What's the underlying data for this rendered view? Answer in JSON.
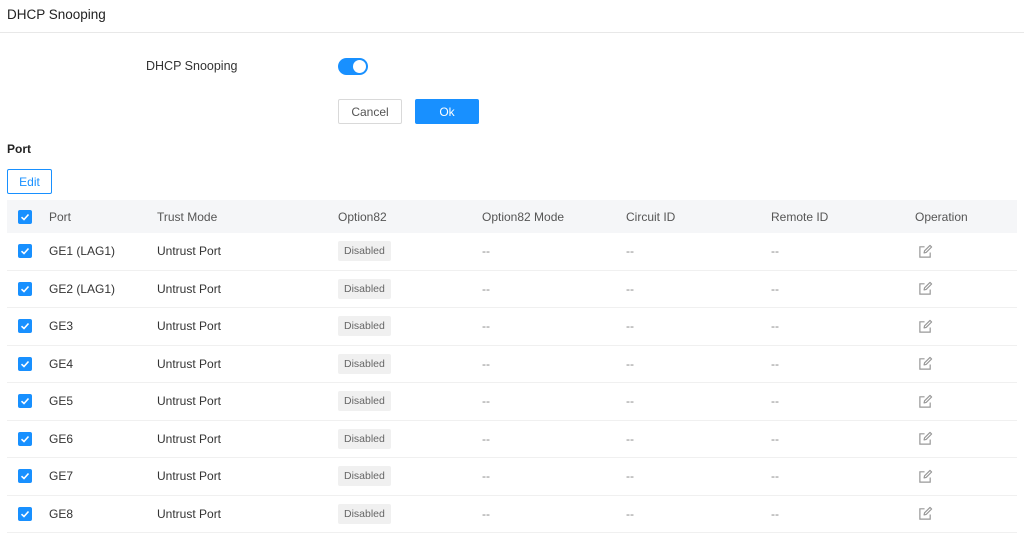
{
  "page": {
    "title": "DHCP Snooping"
  },
  "settings": {
    "dhcp_snooping_label": "DHCP Snooping",
    "dhcp_snooping_enabled": true,
    "cancel_label": "Cancel",
    "ok_label": "Ok"
  },
  "port_section": {
    "title": "Port",
    "edit_label": "Edit",
    "columns": {
      "port": "Port",
      "trust_mode": "Trust Mode",
      "option82": "Option82",
      "option82_mode": "Option82 Mode",
      "circuit_id": "Circuit ID",
      "remote_id": "Remote ID",
      "operation": "Operation"
    },
    "rows": [
      {
        "port": "GE1 (LAG1)",
        "trust_mode": "Untrust Port",
        "option82": "Disabled",
        "option82_mode": "--",
        "circuit_id": "--",
        "remote_id": "--",
        "checked": true
      },
      {
        "port": "GE2 (LAG1)",
        "trust_mode": "Untrust Port",
        "option82": "Disabled",
        "option82_mode": "--",
        "circuit_id": "--",
        "remote_id": "--",
        "checked": true
      },
      {
        "port": "GE3",
        "trust_mode": "Untrust Port",
        "option82": "Disabled",
        "option82_mode": "--",
        "circuit_id": "--",
        "remote_id": "--",
        "checked": true
      },
      {
        "port": "GE4",
        "trust_mode": "Untrust Port",
        "option82": "Disabled",
        "option82_mode": "--",
        "circuit_id": "--",
        "remote_id": "--",
        "checked": true
      },
      {
        "port": "GE5",
        "trust_mode": "Untrust Port",
        "option82": "Disabled",
        "option82_mode": "--",
        "circuit_id": "--",
        "remote_id": "--",
        "checked": true
      },
      {
        "port": "GE6",
        "trust_mode": "Untrust Port",
        "option82": "Disabled",
        "option82_mode": "--",
        "circuit_id": "--",
        "remote_id": "--",
        "checked": true
      },
      {
        "port": "GE7",
        "trust_mode": "Untrust Port",
        "option82": "Disabled",
        "option82_mode": "--",
        "circuit_id": "--",
        "remote_id": "--",
        "checked": true
      },
      {
        "port": "GE8",
        "trust_mode": "Untrust Port",
        "option82": "Disabled",
        "option82_mode": "--",
        "circuit_id": "--",
        "remote_id": "--",
        "checked": true
      }
    ]
  },
  "icons": {
    "checkbox": "check-icon",
    "operation": "edit-icon"
  },
  "colors": {
    "accent": "#1890ff",
    "header_bg": "#f5f6f8",
    "badge_bg": "#f0f0f0"
  }
}
